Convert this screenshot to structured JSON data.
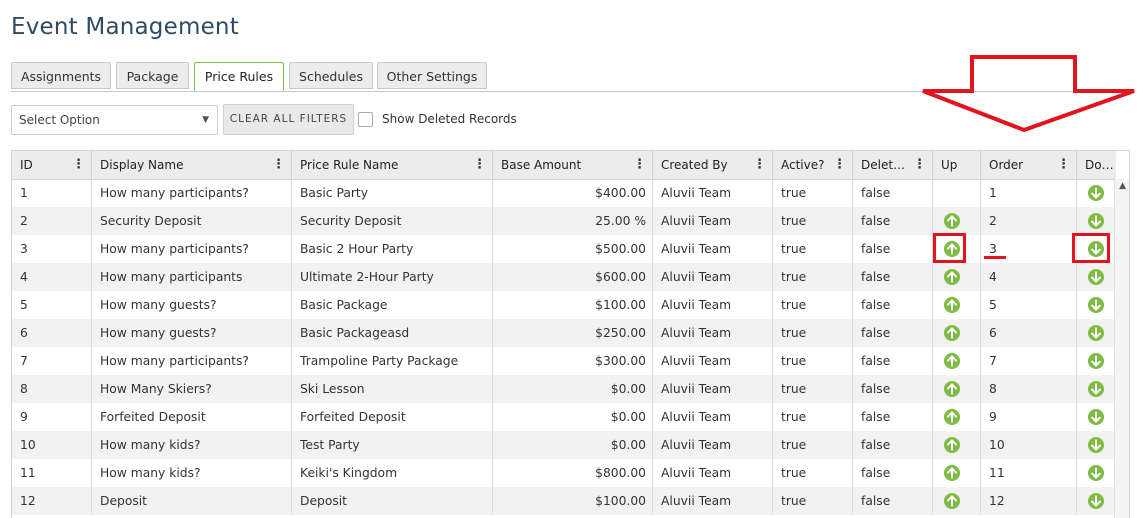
{
  "page": {
    "title": "Event Management"
  },
  "tabs": [
    {
      "label": "Assignments",
      "active": false
    },
    {
      "label": "Package",
      "active": false
    },
    {
      "label": "Price Rules",
      "active": true
    },
    {
      "label": "Schedules",
      "active": false
    },
    {
      "label": "Other Settings",
      "active": false
    }
  ],
  "filters": {
    "select_value": "Select Option",
    "clear_label": "CLEAR ALL FILTERS",
    "show_deleted_label": "Show Deleted Records",
    "show_deleted_checked": false
  },
  "grid": {
    "columns": [
      "ID",
      "Display Name",
      "Price Rule Name",
      "Base Amount",
      "Created By",
      "Active?",
      "Delet…",
      "Up",
      "Order",
      "Do…"
    ],
    "rows": [
      {
        "id": "1",
        "display_name": "How many participants?",
        "rule_name": "Basic Party",
        "base_amount": "$400.00",
        "created_by": "Aluvii Team",
        "active": "true",
        "deleted": "false",
        "up": false,
        "order": "1",
        "down": true
      },
      {
        "id": "2",
        "display_name": "Security Deposit",
        "rule_name": "Security Deposit",
        "base_amount": "25.00 %",
        "created_by": "Aluvii Team",
        "active": "true",
        "deleted": "false",
        "up": true,
        "order": "2",
        "down": true
      },
      {
        "id": "3",
        "display_name": "How many participants?",
        "rule_name": "Basic 2 Hour Party",
        "base_amount": "$500.00",
        "created_by": "Aluvii Team",
        "active": "true",
        "deleted": "false",
        "up": true,
        "order": "3",
        "down": true
      },
      {
        "id": "4",
        "display_name": "How many participants",
        "rule_name": "Ultimate 2-Hour Party",
        "base_amount": "$600.00",
        "created_by": "Aluvii Team",
        "active": "true",
        "deleted": "false",
        "up": true,
        "order": "4",
        "down": true
      },
      {
        "id": "5",
        "display_name": "How many guests?",
        "rule_name": "Basic Package",
        "base_amount": "$100.00",
        "created_by": "Aluvii Team",
        "active": "true",
        "deleted": "false",
        "up": true,
        "order": "5",
        "down": true
      },
      {
        "id": "6",
        "display_name": "How many guests?",
        "rule_name": "Basic Packageasd",
        "base_amount": "$250.00",
        "created_by": "Aluvii Team",
        "active": "true",
        "deleted": "false",
        "up": true,
        "order": "6",
        "down": true
      },
      {
        "id": "7",
        "display_name": "How many participants?",
        "rule_name": "Trampoline Party Package",
        "base_amount": "$300.00",
        "created_by": "Aluvii Team",
        "active": "true",
        "deleted": "false",
        "up": true,
        "order": "7",
        "down": true
      },
      {
        "id": "8",
        "display_name": "How Many Skiers?",
        "rule_name": "Ski Lesson",
        "base_amount": "$0.00",
        "created_by": "Aluvii Team",
        "active": "true",
        "deleted": "false",
        "up": true,
        "order": "8",
        "down": true
      },
      {
        "id": "9",
        "display_name": "Forfeited Deposit",
        "rule_name": "Forfeited Deposit",
        "base_amount": "$0.00",
        "created_by": "Aluvii Team",
        "active": "true",
        "deleted": "false",
        "up": true,
        "order": "9",
        "down": true
      },
      {
        "id": "10",
        "display_name": "How many kids?",
        "rule_name": "Test Party",
        "base_amount": "$0.00",
        "created_by": "Aluvii Team",
        "active": "true",
        "deleted": "false",
        "up": true,
        "order": "10",
        "down": true
      },
      {
        "id": "11",
        "display_name": "How many kids?",
        "rule_name": "Keiki's Kingdom",
        "base_amount": "$800.00",
        "created_by": "Aluvii Team",
        "active": "true",
        "deleted": "false",
        "up": true,
        "order": "11",
        "down": true
      },
      {
        "id": "12",
        "display_name": "Deposit",
        "rule_name": "Deposit",
        "base_amount": "$100.00",
        "created_by": "Aluvii Team",
        "active": "true",
        "deleted": "false",
        "up": true,
        "order": "12",
        "down": true
      }
    ]
  },
  "icons": {
    "up": "arrow-up-circle-icon",
    "down": "arrow-down-circle-icon",
    "column_menu": "vertical-ellipsis-icon",
    "dropdown": "caret-down-icon"
  },
  "colors": {
    "accent_green": "#7dbb42",
    "annotation_red": "#e2141e",
    "title_blue": "#2f4a63"
  }
}
